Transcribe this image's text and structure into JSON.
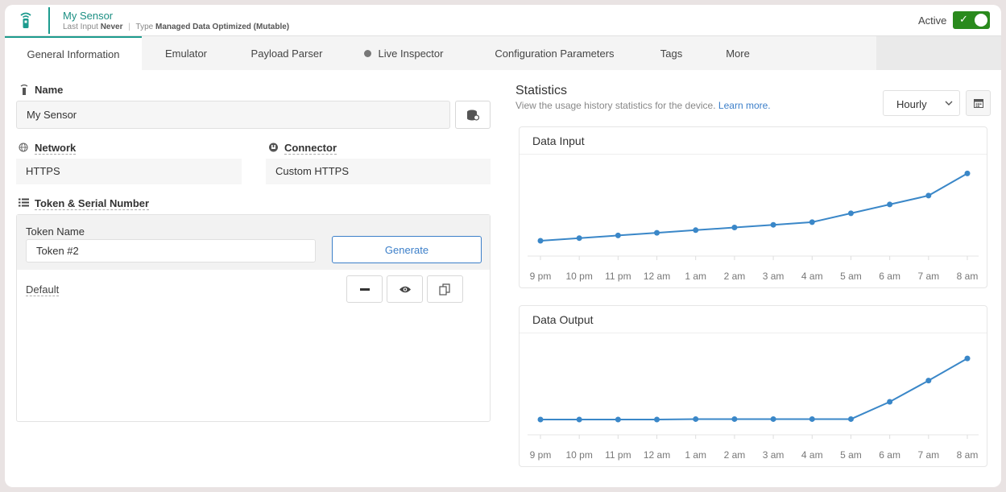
{
  "header": {
    "title": "My Sensor",
    "last_input_label": "Last Input",
    "last_input_value": "Never",
    "separator": "|",
    "type_label": "Type",
    "type_value": "Managed Data Optimized (Mutable)",
    "active_label": "Active",
    "active_on": true
  },
  "tabs": [
    {
      "label": "General Information",
      "active": true
    },
    {
      "label": "Emulator"
    },
    {
      "label": "Payload Parser"
    },
    {
      "label": "Live Inspector",
      "status_dot": true
    },
    {
      "label": "Configuration Parameters"
    },
    {
      "label": "Tags"
    },
    {
      "label": "More"
    }
  ],
  "form": {
    "name_label": "Name",
    "name_value": "My Sensor",
    "network_label": "Network",
    "network_value": "HTTPS",
    "connector_label": "Connector",
    "connector_value": "Custom HTTPS",
    "token_section_label": "Token & Serial Number",
    "token_name_label": "Token Name",
    "token_name_value": "Token #2",
    "generate_label": "Generate",
    "default_label": "Default"
  },
  "statistics": {
    "title": "Statistics",
    "subtitle": "View the usage history statistics for the device.",
    "learn_more": "Learn more.",
    "interval": "Hourly"
  },
  "icons": {
    "device": "device-antenna-icon",
    "database": "database-icon",
    "network": "globe-icon",
    "connector": "plug-icon",
    "token": "list-icon",
    "remove": "minus-icon",
    "view": "eye-icon",
    "copy": "copy-icon",
    "calendar": "calendar-icon",
    "chevron": "chevron-down-icon"
  },
  "colors": {
    "accent": "#1c9b8e",
    "active_green": "#2a8a1d",
    "link_blue": "#3c7fc9",
    "series_blue": "#3a87c8"
  },
  "chart_data": [
    {
      "type": "line",
      "title": "Data Input",
      "categories": [
        "9 pm",
        "10 pm",
        "11 pm",
        "12 am",
        "1 am",
        "2 am",
        "3 am",
        "4 am",
        "5 am",
        "6 am",
        "7 am",
        "8 am"
      ],
      "values": [
        1.0,
        1.3,
        1.6,
        1.9,
        2.2,
        2.5,
        2.8,
        3.1,
        4.1,
        5.1,
        6.1,
        8.6
      ],
      "ylim": [
        0,
        10
      ],
      "grid": false
    },
    {
      "type": "line",
      "title": "Data Output",
      "categories": [
        "9 pm",
        "10 pm",
        "11 pm",
        "12 am",
        "1 am",
        "2 am",
        "3 am",
        "4 am",
        "5 am",
        "6 am",
        "7 am",
        "8 am"
      ],
      "values": [
        1.0,
        1.0,
        1.0,
        1.0,
        1.05,
        1.05,
        1.05,
        1.05,
        1.05,
        3.0,
        5.4,
        7.9
      ],
      "ylim": [
        0,
        10
      ],
      "grid": false
    }
  ]
}
